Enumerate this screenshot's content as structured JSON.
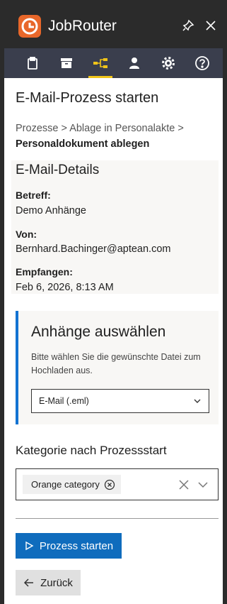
{
  "app": {
    "title": "JobRouter"
  },
  "icons": {
    "logo": "jobrouter-logo-icon",
    "pin": "pin-icon",
    "close": "close-icon",
    "toolbar": [
      "clipboard-icon",
      "archive-icon",
      "process-flow-icon",
      "user-icon",
      "gear-icon",
      "help-icon"
    ],
    "chevron": "chevron-down-icon",
    "tag_remove": "circle-x-icon",
    "clear": "x-icon",
    "start": "play-outline-icon",
    "back": "arrow-left-icon"
  },
  "colors": {
    "accent": "#0f6cbd",
    "active_tab": "#f0c419",
    "logo": "#e8672a",
    "attach_border": "#1273d2"
  },
  "toolbar": {
    "active_index": 2
  },
  "page": {
    "title": "E-Mail-Prozess starten",
    "breadcrumb": {
      "items": [
        "Prozesse",
        "Ablage in Personalakte"
      ],
      "separator": ">",
      "current": "Personaldokument ablegen"
    }
  },
  "details": {
    "heading": "E-Mail-Details",
    "subject_label": "Betreff:",
    "subject": "Demo Anhänge",
    "from_label": "Von:",
    "from": "Bernhard.Bachinger@aptean.com",
    "received_label": "Empfangen:",
    "received": "Feb 6, 2026, 8:13 AM"
  },
  "attachments": {
    "heading": "Anhänge auswählen",
    "hint": "Bitte wählen Sie die gewünschte Datei zum Hochladen aus.",
    "selected": "E-Mail (.eml)"
  },
  "category": {
    "label": "Kategorie nach Prozessstart",
    "tags": [
      "Orange category"
    ]
  },
  "actions": {
    "start": "Prozess starten",
    "back": "Zurück"
  }
}
